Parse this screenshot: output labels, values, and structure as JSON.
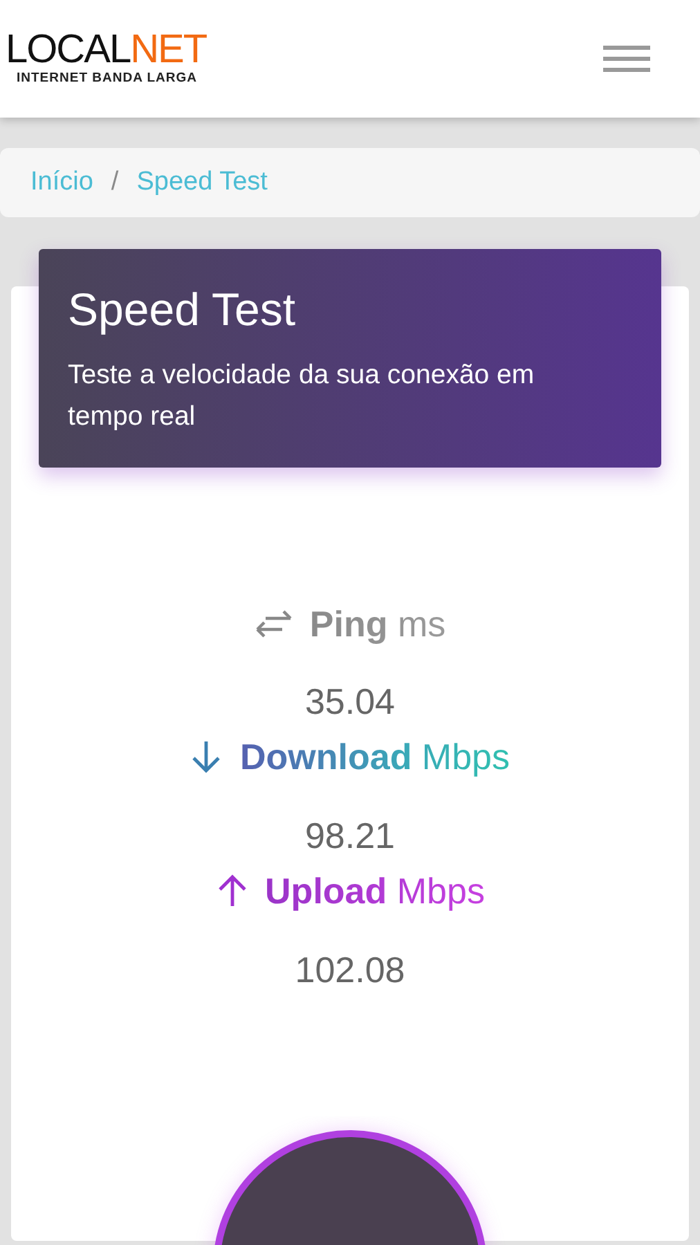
{
  "logo": {
    "main": "LOCAL",
    "accent": "NET",
    "tagline": "INTERNET BANDA LARGA"
  },
  "breadcrumb": [
    {
      "label": "Início"
    },
    {
      "label": "Speed Test"
    }
  ],
  "breadcrumb_separator": "/",
  "header": {
    "title": "Speed Test",
    "subtitle": "Teste a velocidade da sua conexão em tempo real"
  },
  "metrics": [
    {
      "kind": "ping",
      "label": "Ping",
      "unit": "ms",
      "value": "35.04"
    },
    {
      "kind": "download",
      "label": "Download",
      "unit": "Mbps",
      "value": "98.21"
    },
    {
      "kind": "upload",
      "label": "Upload",
      "unit": "Mbps",
      "value": "102.08"
    }
  ]
}
